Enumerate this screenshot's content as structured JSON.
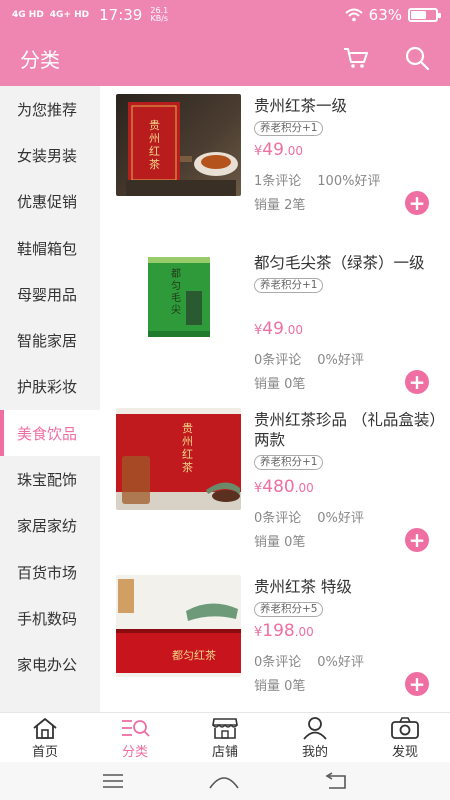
{
  "status": {
    "sig1": "4G HD",
    "sig2": "4G+ HD",
    "time": "17:39",
    "speed_value": "26.1",
    "speed_unit": "KB/s",
    "battery": "63%",
    "battery_level": 0.63
  },
  "header": {
    "title": "分类",
    "cart_icon": "cart-icon",
    "search_icon": "search-icon"
  },
  "sidebar": {
    "items": [
      {
        "label": "为您推荐"
      },
      {
        "label": "女装男装"
      },
      {
        "label": "优惠促销"
      },
      {
        "label": "鞋帽箱包"
      },
      {
        "label": "母婴用品"
      },
      {
        "label": "智能家居"
      },
      {
        "label": "护肤彩妆"
      },
      {
        "label": "美食饮品"
      },
      {
        "label": "珠宝配饰"
      },
      {
        "label": "家居家纺"
      },
      {
        "label": "百货市场"
      },
      {
        "label": "手机数码"
      },
      {
        "label": "家电办公"
      }
    ],
    "active_index": 7
  },
  "products": [
    {
      "name": "贵州红茶一级",
      "badge": "养老积分+1",
      "price_symbol": "¥",
      "price_int": "49",
      "price_dec": ".00",
      "reviews": "1条评论",
      "rating": "100%好评",
      "sales": "销量 2笔",
      "image_text": "贵州红茶"
    },
    {
      "name": "都匀毛尖茶（绿茶）一级",
      "badge": "养老积分+1",
      "price_symbol": "¥",
      "price_int": "49",
      "price_dec": ".00",
      "reviews": "0条评论",
      "rating": "0%好评",
      "sales": "销量 0笔",
      "image_text": "都匀毛尖"
    },
    {
      "name": "贵州红茶珍品 （礼品盒装）两款",
      "badge": "养老积分+1",
      "price_symbol": "¥",
      "price_int": "480",
      "price_dec": ".00",
      "reviews": "0条评论",
      "rating": "0%好评",
      "sales": "销量 0笔",
      "image_text": "贵州红茶"
    },
    {
      "name": "贵州红茶 特级",
      "badge": "养老积分+5",
      "price_symbol": "¥",
      "price_int": "198",
      "price_dec": ".00",
      "reviews": "0条评论",
      "rating": "0%好评",
      "sales": "销量 0笔",
      "image_text": "都匀红茶"
    }
  ],
  "tabs": [
    {
      "label": "首页",
      "icon": "home-icon"
    },
    {
      "label": "分类",
      "icon": "category-icon"
    },
    {
      "label": "店铺",
      "icon": "store-icon"
    },
    {
      "label": "我的",
      "icon": "user-icon"
    },
    {
      "label": "发现",
      "icon": "camera-icon"
    }
  ],
  "active_tab": 1,
  "colors": {
    "brand": "#ef86b2",
    "accent": "#ef6fa3",
    "sidebar_bg": "#f2f2f2"
  }
}
